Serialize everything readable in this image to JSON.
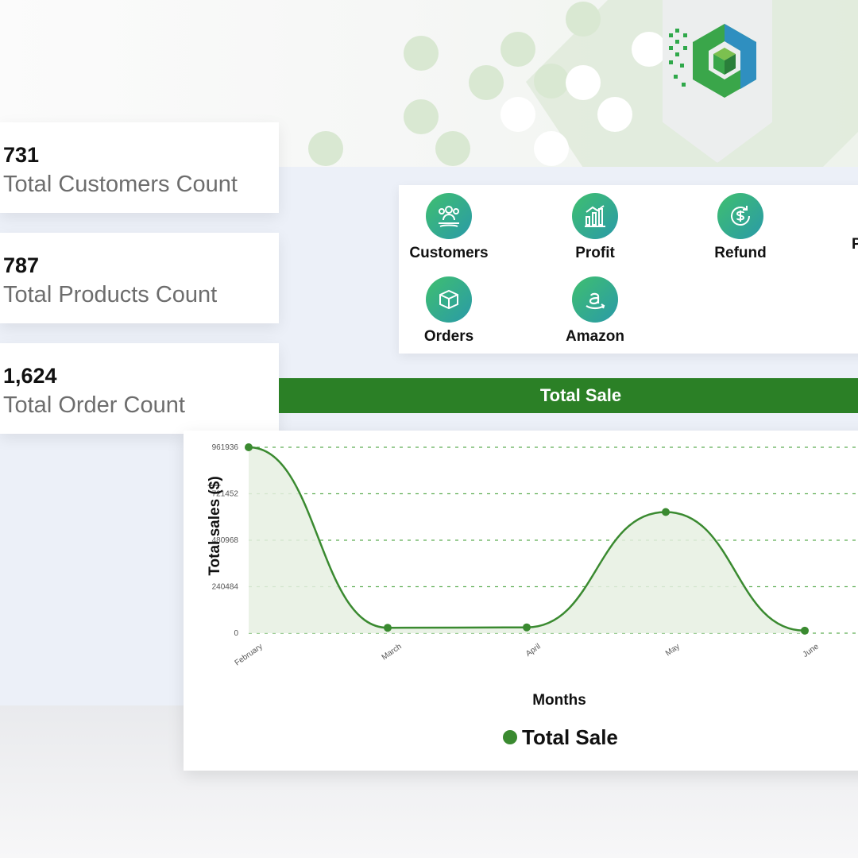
{
  "stats": [
    {
      "value": "731",
      "label": "Total Customers Count"
    },
    {
      "value": "787",
      "label": "Total Products Count"
    },
    {
      "value": "1,624",
      "label": "Total Order Count"
    }
  ],
  "shortcuts": [
    {
      "label": "Customers",
      "icon": "customers-icon"
    },
    {
      "label": "Profit",
      "icon": "profit-icon"
    },
    {
      "label": "Refund",
      "icon": "refund-icon"
    },
    {
      "label": "Orders",
      "icon": "orders-icon"
    },
    {
      "label": "Amazon",
      "icon": "amazon-icon"
    }
  ],
  "chart_data": {
    "type": "area",
    "title": "Total Sale",
    "xlabel": "Months",
    "ylabel": "Total sales ($)",
    "categories": [
      "February",
      "March",
      "April",
      "May",
      "June"
    ],
    "yticks": [
      "0",
      "240484",
      "480968",
      "721452",
      "961936"
    ],
    "ylim": [
      0,
      961936
    ],
    "series": [
      {
        "name": "Total Sale",
        "values": [
          961936,
          28000,
          30000,
          627000,
          13000
        ]
      }
    ],
    "legend": "bottom-center",
    "grid": true
  },
  "colors": {
    "accent": "#2b8026",
    "line": "#3a8a30",
    "fill": "#e6f0e2",
    "icon_gradient_start": "#3fbf6f",
    "icon_gradient_end": "#2a9aa8"
  }
}
